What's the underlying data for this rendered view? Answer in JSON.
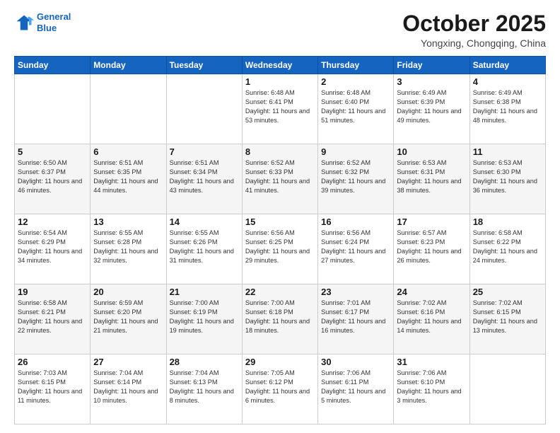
{
  "header": {
    "logo_line1": "General",
    "logo_line2": "Blue",
    "month": "October 2025",
    "location": "Yongxing, Chongqing, China"
  },
  "weekdays": [
    "Sunday",
    "Monday",
    "Tuesday",
    "Wednesday",
    "Thursday",
    "Friday",
    "Saturday"
  ],
  "weeks": [
    [
      {
        "day": "",
        "info": ""
      },
      {
        "day": "",
        "info": ""
      },
      {
        "day": "",
        "info": ""
      },
      {
        "day": "1",
        "info": "Sunrise: 6:48 AM\nSunset: 6:41 PM\nDaylight: 11 hours\nand 53 minutes."
      },
      {
        "day": "2",
        "info": "Sunrise: 6:48 AM\nSunset: 6:40 PM\nDaylight: 11 hours\nand 51 minutes."
      },
      {
        "day": "3",
        "info": "Sunrise: 6:49 AM\nSunset: 6:39 PM\nDaylight: 11 hours\nand 49 minutes."
      },
      {
        "day": "4",
        "info": "Sunrise: 6:49 AM\nSunset: 6:38 PM\nDaylight: 11 hours\nand 48 minutes."
      }
    ],
    [
      {
        "day": "5",
        "info": "Sunrise: 6:50 AM\nSunset: 6:37 PM\nDaylight: 11 hours\nand 46 minutes."
      },
      {
        "day": "6",
        "info": "Sunrise: 6:51 AM\nSunset: 6:35 PM\nDaylight: 11 hours\nand 44 minutes."
      },
      {
        "day": "7",
        "info": "Sunrise: 6:51 AM\nSunset: 6:34 PM\nDaylight: 11 hours\nand 43 minutes."
      },
      {
        "day": "8",
        "info": "Sunrise: 6:52 AM\nSunset: 6:33 PM\nDaylight: 11 hours\nand 41 minutes."
      },
      {
        "day": "9",
        "info": "Sunrise: 6:52 AM\nSunset: 6:32 PM\nDaylight: 11 hours\nand 39 minutes."
      },
      {
        "day": "10",
        "info": "Sunrise: 6:53 AM\nSunset: 6:31 PM\nDaylight: 11 hours\nand 38 minutes."
      },
      {
        "day": "11",
        "info": "Sunrise: 6:53 AM\nSunset: 6:30 PM\nDaylight: 11 hours\nand 36 minutes."
      }
    ],
    [
      {
        "day": "12",
        "info": "Sunrise: 6:54 AM\nSunset: 6:29 PM\nDaylight: 11 hours\nand 34 minutes."
      },
      {
        "day": "13",
        "info": "Sunrise: 6:55 AM\nSunset: 6:28 PM\nDaylight: 11 hours\nand 32 minutes."
      },
      {
        "day": "14",
        "info": "Sunrise: 6:55 AM\nSunset: 6:26 PM\nDaylight: 11 hours\nand 31 minutes."
      },
      {
        "day": "15",
        "info": "Sunrise: 6:56 AM\nSunset: 6:25 PM\nDaylight: 11 hours\nand 29 minutes."
      },
      {
        "day": "16",
        "info": "Sunrise: 6:56 AM\nSunset: 6:24 PM\nDaylight: 11 hours\nand 27 minutes."
      },
      {
        "day": "17",
        "info": "Sunrise: 6:57 AM\nSunset: 6:23 PM\nDaylight: 11 hours\nand 26 minutes."
      },
      {
        "day": "18",
        "info": "Sunrise: 6:58 AM\nSunset: 6:22 PM\nDaylight: 11 hours\nand 24 minutes."
      }
    ],
    [
      {
        "day": "19",
        "info": "Sunrise: 6:58 AM\nSunset: 6:21 PM\nDaylight: 11 hours\nand 22 minutes."
      },
      {
        "day": "20",
        "info": "Sunrise: 6:59 AM\nSunset: 6:20 PM\nDaylight: 11 hours\nand 21 minutes."
      },
      {
        "day": "21",
        "info": "Sunrise: 7:00 AM\nSunset: 6:19 PM\nDaylight: 11 hours\nand 19 minutes."
      },
      {
        "day": "22",
        "info": "Sunrise: 7:00 AM\nSunset: 6:18 PM\nDaylight: 11 hours\nand 18 minutes."
      },
      {
        "day": "23",
        "info": "Sunrise: 7:01 AM\nSunset: 6:17 PM\nDaylight: 11 hours\nand 16 minutes."
      },
      {
        "day": "24",
        "info": "Sunrise: 7:02 AM\nSunset: 6:16 PM\nDaylight: 11 hours\nand 14 minutes."
      },
      {
        "day": "25",
        "info": "Sunrise: 7:02 AM\nSunset: 6:15 PM\nDaylight: 11 hours\nand 13 minutes."
      }
    ],
    [
      {
        "day": "26",
        "info": "Sunrise: 7:03 AM\nSunset: 6:15 PM\nDaylight: 11 hours\nand 11 minutes."
      },
      {
        "day": "27",
        "info": "Sunrise: 7:04 AM\nSunset: 6:14 PM\nDaylight: 11 hours\nand 10 minutes."
      },
      {
        "day": "28",
        "info": "Sunrise: 7:04 AM\nSunset: 6:13 PM\nDaylight: 11 hours\nand 8 minutes."
      },
      {
        "day": "29",
        "info": "Sunrise: 7:05 AM\nSunset: 6:12 PM\nDaylight: 11 hours\nand 6 minutes."
      },
      {
        "day": "30",
        "info": "Sunrise: 7:06 AM\nSunset: 6:11 PM\nDaylight: 11 hours\nand 5 minutes."
      },
      {
        "day": "31",
        "info": "Sunrise: 7:06 AM\nSunset: 6:10 PM\nDaylight: 11 hours\nand 3 minutes."
      },
      {
        "day": "",
        "info": ""
      }
    ]
  ]
}
